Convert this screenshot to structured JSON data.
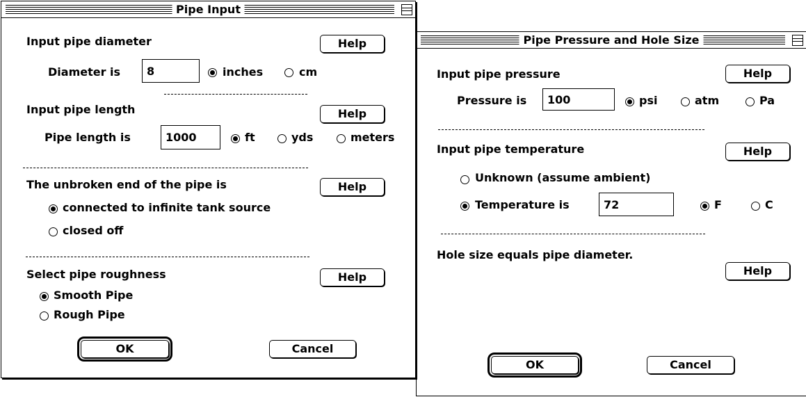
{
  "pipe_input": {
    "title": "Pipe Input",
    "diameter": {
      "heading": "Input pipe diameter",
      "help": "Help",
      "label": "Diameter is",
      "value": "8",
      "units": [
        "inches",
        "cm"
      ],
      "selected_unit": "inches"
    },
    "length": {
      "heading": "Input pipe length",
      "help": "Help",
      "label": "Pipe length is",
      "value": "1000",
      "units": [
        "ft",
        "yds",
        "meters"
      ],
      "selected_unit": "ft"
    },
    "end": {
      "heading": "The unbroken end of the pipe is",
      "help": "Help",
      "options": [
        "connected to infinite tank source",
        "closed off"
      ],
      "selected": "connected to infinite tank source"
    },
    "roughness": {
      "heading": "Select pipe roughness",
      "help": "Help",
      "options": [
        "Smooth Pipe",
        "Rough Pipe"
      ],
      "selected": "Smooth Pipe"
    },
    "ok": "OK",
    "cancel": "Cancel"
  },
  "pressure_hole": {
    "title": "Pipe Pressure and Hole Size",
    "pressure": {
      "heading": "Input pipe pressure",
      "help": "Help",
      "label": "Pressure is",
      "value": "100",
      "units": [
        "psi",
        "atm",
        "Pa"
      ],
      "selected_unit": "psi"
    },
    "temperature": {
      "heading": "Input pipe temperature",
      "help": "Help",
      "unknown_label": "Unknown (assume ambient)",
      "known_label": "Temperature is",
      "value": "72",
      "units": [
        "F",
        "C"
      ],
      "selected_unit": "F",
      "selected_mode": "Temperature is"
    },
    "hole": {
      "text": "Hole size equals pipe diameter.",
      "help": "Help"
    },
    "ok": "OK",
    "cancel": "Cancel"
  }
}
